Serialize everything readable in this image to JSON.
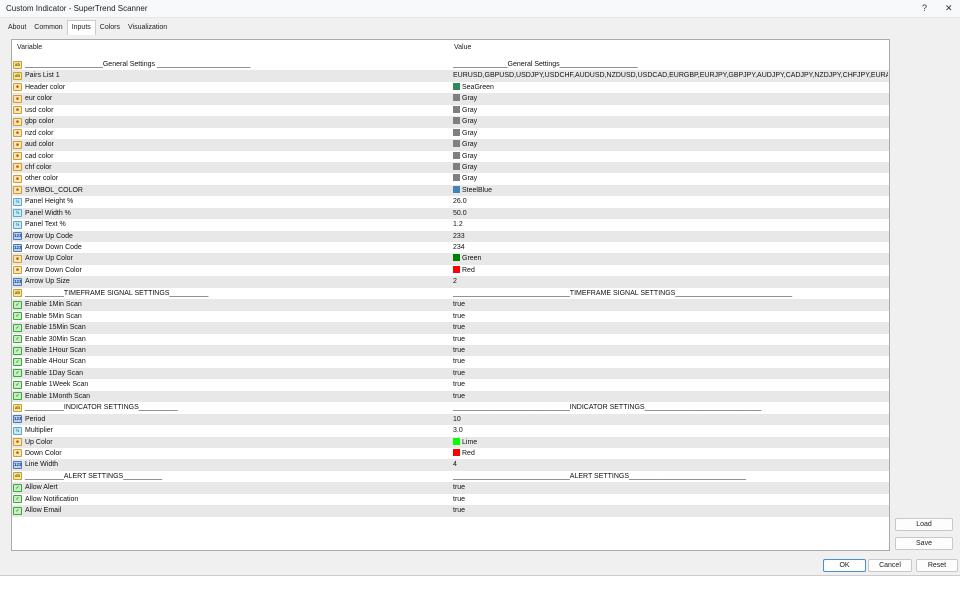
{
  "window": {
    "title": "Custom Indicator - SuperTrend Scanner",
    "help": "?",
    "close": "✕"
  },
  "tabs": [
    "About",
    "Common",
    "Inputs",
    "Colors",
    "Visualization"
  ],
  "active_tab": "Inputs",
  "table": {
    "col_variable": "Variable",
    "col_value": "Value"
  },
  "rows": [
    {
      "icon": "ab",
      "variable": "____________________General Settings ________________________",
      "value": "______________General Settings____________________"
    },
    {
      "icon": "ab",
      "variable": "Pairs List 1",
      "value": "EURUSD,GBPUSD,USDJPY,USDCHF,AUDUSD,NZDUSD,USDCAD,EURGBP,EURJPY,GBPJPY,AUDJPY,CADJPY,NZDJPY,CHFJPY,EURAUD,GBPAUD,..."
    },
    {
      "icon": "color",
      "variable": "Header color",
      "value": "SeaGreen",
      "swatch": "#2e8b57"
    },
    {
      "icon": "color",
      "variable": "eur color",
      "value": "Gray",
      "swatch": "#808080"
    },
    {
      "icon": "color",
      "variable": "usd color",
      "value": "Gray",
      "swatch": "#808080"
    },
    {
      "icon": "color",
      "variable": "gbp color",
      "value": "Gray",
      "swatch": "#808080"
    },
    {
      "icon": "color",
      "variable": "nzd color",
      "value": "Gray",
      "swatch": "#808080"
    },
    {
      "icon": "color",
      "variable": "aud color",
      "value": "Gray",
      "swatch": "#808080"
    },
    {
      "icon": "color",
      "variable": "cad color",
      "value": "Gray",
      "swatch": "#808080"
    },
    {
      "icon": "color",
      "variable": "chf color",
      "value": "Gray",
      "swatch": "#808080"
    },
    {
      "icon": "color",
      "variable": "other color",
      "value": "Gray",
      "swatch": "#808080"
    },
    {
      "icon": "color",
      "variable": "SYMBOL_COLOR",
      "value": "SteelBlue",
      "swatch": "#4682b4"
    },
    {
      "icon": "double",
      "variable": "Panel Height %",
      "value": "26.0"
    },
    {
      "icon": "double",
      "variable": "Panel Width %",
      "value": "50.0"
    },
    {
      "icon": "double",
      "variable": "Panel Text %",
      "value": "1.2"
    },
    {
      "icon": "int",
      "variable": "Arrow Up Code",
      "value": "233"
    },
    {
      "icon": "int",
      "variable": "Arrow Down Code",
      "value": "234"
    },
    {
      "icon": "color",
      "variable": "Arrow Up Color",
      "value": "Green",
      "swatch": "#008000"
    },
    {
      "icon": "color",
      "variable": "Arrow Down Color",
      "value": "Red",
      "swatch": "#ff0000"
    },
    {
      "icon": "int",
      "variable": "Arrow Up Size",
      "value": "2"
    },
    {
      "icon": "ab",
      "variable": "__________TIMEFRAME SIGNAL SETTINGS__________",
      "value": "______________________________TIMEFRAME SIGNAL SETTINGS______________________________"
    },
    {
      "icon": "bool",
      "variable": "Enable 1Min Scan",
      "value": "true"
    },
    {
      "icon": "bool",
      "variable": "Enable 5Min Scan",
      "value": "true"
    },
    {
      "icon": "bool",
      "variable": "Enable 15Min Scan",
      "value": "true"
    },
    {
      "icon": "bool",
      "variable": "Enable 30Min Scan",
      "value": "true"
    },
    {
      "icon": "bool",
      "variable": "Enable 1Hour Scan",
      "value": "true"
    },
    {
      "icon": "bool",
      "variable": "Enable 4Hour Scan",
      "value": "true"
    },
    {
      "icon": "bool",
      "variable": "Enable 1Day Scan",
      "value": "true"
    },
    {
      "icon": "bool",
      "variable": "Enable 1Week Scan",
      "value": "true"
    },
    {
      "icon": "bool",
      "variable": "Enable 1Month Scan",
      "value": "true"
    },
    {
      "icon": "ab",
      "variable": "__________INDICATOR SETTINGS__________",
      "value": "______________________________INDICATOR SETTINGS______________________________"
    },
    {
      "icon": "int",
      "variable": "Period",
      "value": "10"
    },
    {
      "icon": "double",
      "variable": "Multiplier",
      "value": "3.0"
    },
    {
      "icon": "color",
      "variable": "Up Color",
      "value": "Lime",
      "swatch": "#00ff00"
    },
    {
      "icon": "color",
      "variable": "Down Color",
      "value": "Red",
      "swatch": "#ff0000"
    },
    {
      "icon": "int",
      "variable": "Line Width",
      "value": "4"
    },
    {
      "icon": "ab",
      "variable": "__________ALERT SETTINGS__________",
      "value": "______________________________ALERT SETTINGS______________________________"
    },
    {
      "icon": "bool",
      "variable": "Allow Alert",
      "value": "true"
    },
    {
      "icon": "bool",
      "variable": "Allow Notification",
      "value": "true"
    },
    {
      "icon": "bool",
      "variable": "Allow Email",
      "value": "true"
    }
  ],
  "buttons": {
    "load": "Load",
    "save": "Save",
    "ok": "OK",
    "cancel": "Cancel",
    "reset": "Reset"
  }
}
